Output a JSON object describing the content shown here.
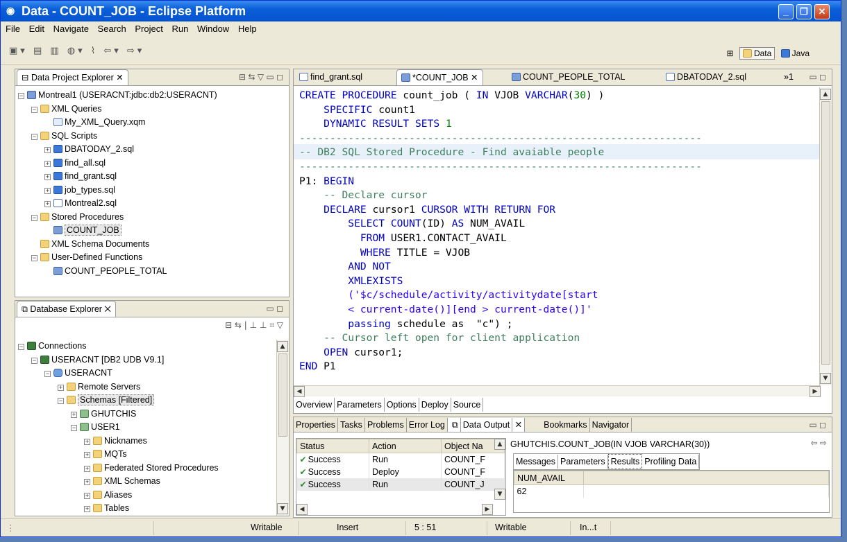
{
  "window": {
    "title": "Data - COUNT_JOB - Eclipse Platform",
    "min": "_",
    "max": "❐",
    "close": "✕"
  },
  "menu": [
    "File",
    "Edit",
    "Navigate",
    "Search",
    "Project",
    "Run",
    "Window",
    "Help"
  ],
  "perspectives": {
    "data": "Data",
    "java": "Java"
  },
  "project_explorer": {
    "title": "Data Project Explorer",
    "items": [
      {
        "label": "Montreal1 (USERACNT:jdbc:db2:USERACNT)",
        "icon": "project-icon",
        "level": 0,
        "exp": "-"
      },
      {
        "label": "XML Queries",
        "icon": "folder-icon",
        "level": 1,
        "exp": "-"
      },
      {
        "label": "My_XML_Query.xqm",
        "icon": "xml-icon",
        "level": 2,
        "exp": ""
      },
      {
        "label": "SQL Scripts",
        "icon": "folder-icon",
        "level": 1,
        "exp": "-"
      },
      {
        "label": "DBATODAY_2.sql",
        "icon": "sql-icon",
        "level": 2,
        "exp": "+"
      },
      {
        "label": "find_all.sql",
        "icon": "sql-icon",
        "level": 2,
        "exp": "+"
      },
      {
        "label": "find_grant.sql",
        "icon": "sql-icon",
        "level": 2,
        "exp": "+"
      },
      {
        "label": "job_types.sql",
        "icon": "sql-icon",
        "level": 2,
        "exp": "+"
      },
      {
        "label": "Montreal2.sql",
        "icon": "file-icon",
        "level": 2,
        "exp": "+"
      },
      {
        "label": "Stored Procedures",
        "icon": "folder-icon",
        "level": 1,
        "exp": "-"
      },
      {
        "label": "COUNT_JOB",
        "icon": "procedure-icon",
        "level": 2,
        "exp": "",
        "selected": true
      },
      {
        "label": "XML Schema Documents",
        "icon": "folder-icon",
        "level": 1,
        "exp": ""
      },
      {
        "label": "User-Defined Functions",
        "icon": "folder-icon",
        "level": 1,
        "exp": "-"
      },
      {
        "label": "COUNT_PEOPLE_TOTAL",
        "icon": "function-icon",
        "level": 2,
        "exp": ""
      }
    ]
  },
  "database_explorer": {
    "title": "Database Explorer",
    "items": [
      {
        "label": "Connections",
        "icon": "connections-icon",
        "level": 0,
        "exp": "-"
      },
      {
        "label": "USERACNT [DB2 UDB V9.1]",
        "icon": "connection-icon",
        "level": 1,
        "exp": "-"
      },
      {
        "label": "USERACNT",
        "icon": "database-icon",
        "level": 2,
        "exp": "-"
      },
      {
        "label": "Remote Servers",
        "icon": "folder-icon",
        "level": 3,
        "exp": "+"
      },
      {
        "label": "Schemas [Filtered]",
        "icon": "folder-icon",
        "level": 3,
        "exp": "-",
        "selected": true
      },
      {
        "label": "GHUTCHIS",
        "icon": "schema-icon",
        "level": 4,
        "exp": "+"
      },
      {
        "label": "USER1",
        "icon": "schema-icon",
        "level": 4,
        "exp": "-"
      },
      {
        "label": "Nicknames",
        "icon": "folder-icon",
        "level": 5,
        "exp": "+"
      },
      {
        "label": "MQTs",
        "icon": "folder-icon",
        "level": 5,
        "exp": "+"
      },
      {
        "label": "Federated Stored Procedures",
        "icon": "folder-icon",
        "level": 5,
        "exp": "+"
      },
      {
        "label": "XML Schemas",
        "icon": "folder-icon",
        "level": 5,
        "exp": "+"
      },
      {
        "label": "Aliases",
        "icon": "folder-icon",
        "level": 5,
        "exp": "+"
      },
      {
        "label": "Tables",
        "icon": "folder-icon",
        "level": 5,
        "exp": "+"
      }
    ]
  },
  "editor": {
    "tabs": [
      "find_grant.sql",
      "*COUNT_JOB",
      "COUNT_PEOPLE_TOTAL",
      "DBATODAY_2.sql"
    ],
    "overflow": "»1",
    "bottom_tabs": [
      "Overview",
      "Parameters",
      "Options",
      "Deploy",
      "Source"
    ],
    "lines": [
      "CREATE PROCEDURE count_job ( IN VJOB VARCHAR(30) )",
      "    SPECIFIC count1",
      "    DYNAMIC RESULT SETS 1",
      "------------------------------------------------------------------",
      "-- DB2 SQL Stored Procedure - Find avaiable people",
      "------------------------------------------------------------------",
      "P1: BEGIN",
      "    -- Declare cursor",
      "    DECLARE cursor1 CURSOR WITH RETURN FOR",
      "        SELECT COUNT(ID) AS NUM_AVAIL",
      "          FROM USER1.CONTACT_AVAIL",
      "          WHERE TITLE = VJOB",
      "        AND NOT",
      "        XMLEXISTS",
      "        ('$c/schedule/activity/activitydate[start",
      "        < current-date()][end > current-date()]'",
      "        passing schedule as  \"c\") ;",
      "",
      "    -- Cursor left open for client application",
      "    OPEN cursor1;",
      "END P1"
    ]
  },
  "output_tabs": [
    "Properties",
    "Tasks",
    "Problems",
    "Error Log",
    "Data Output",
    "Bookmarks",
    "Navigator"
  ],
  "data_output": {
    "headers": [
      "Status",
      "Action",
      "Object Na"
    ],
    "rows": [
      {
        "status": "Success",
        "action": "Run",
        "object": "COUNT_F"
      },
      {
        "status": "Success",
        "action": "Deploy",
        "object": "COUNT_F"
      },
      {
        "status": "Success",
        "action": "Run",
        "object": "COUNT_J"
      }
    ],
    "signature": "GHUTCHIS.COUNT_JOB(IN VJOB VARCHAR(30))",
    "result_tabs": [
      "Messages",
      "Parameters",
      "Results",
      "Profiling Data"
    ],
    "result_header": "NUM_AVAIL",
    "result_value": "62"
  },
  "status_bar": {
    "writable1": "Writable",
    "insert": "Insert",
    "position": "5 : 51",
    "writable2": "Writable",
    "misc": "In...t"
  }
}
